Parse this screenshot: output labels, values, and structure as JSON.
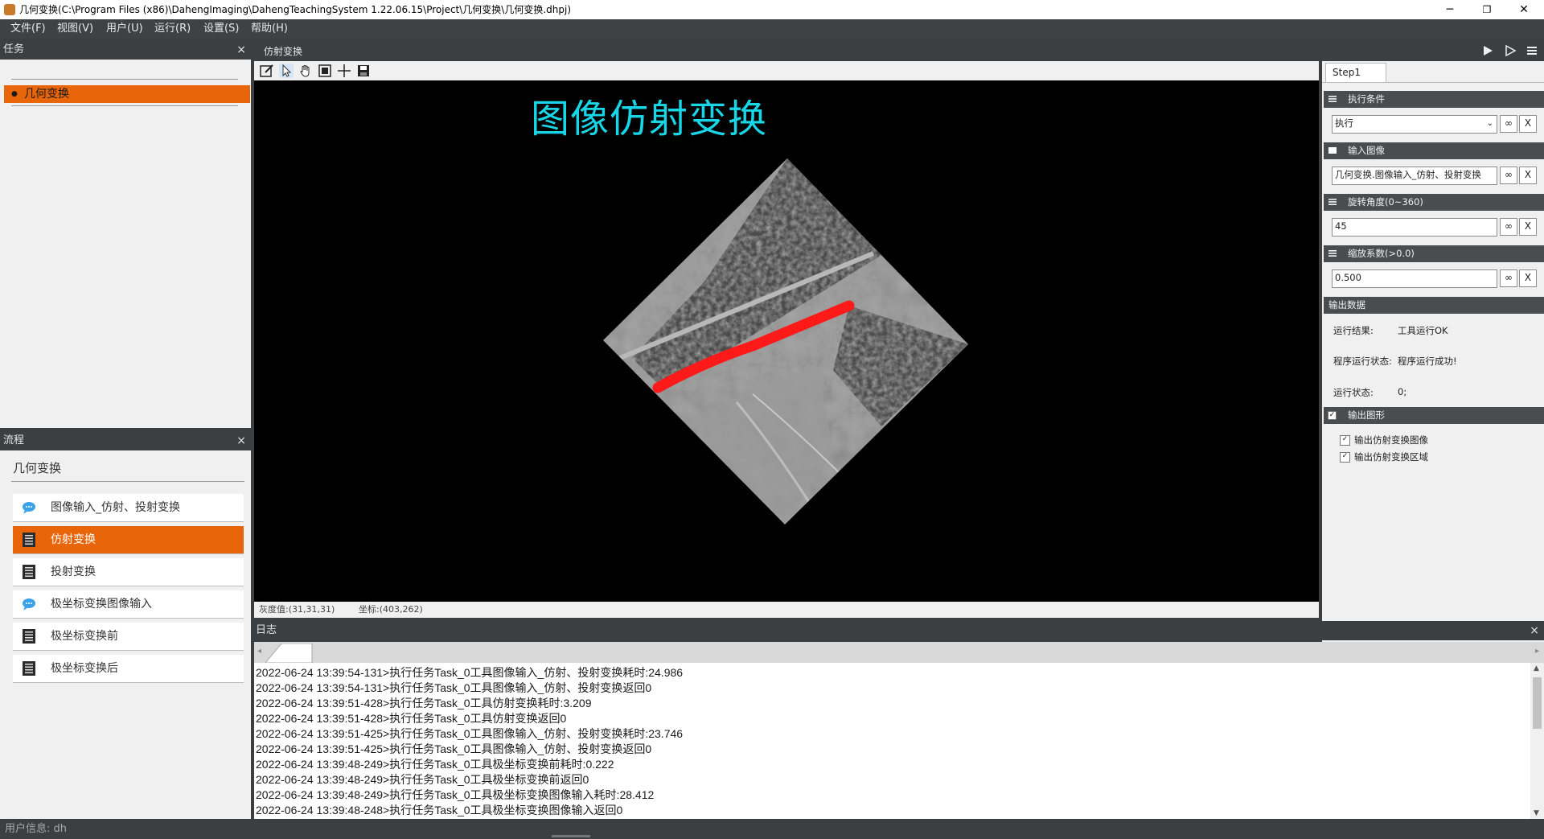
{
  "window": {
    "title": "几何变换(C:\\Program Files (x86)\\DahengImaging\\DahengTeachingSystem 1.22.06.15\\Project\\几何变换\\几何变换.dhpj)",
    "minimize": "─",
    "maximize": "❐",
    "close": "✕"
  },
  "menu": [
    "文件(F)",
    "视图(V)",
    "用户(U)",
    "运行(R)",
    "设置(S)",
    "帮助(H)"
  ],
  "task_panel": {
    "title": "任务",
    "close": "×",
    "items": [
      {
        "label": "几何变换",
        "bullet": "●"
      }
    ]
  },
  "flow_panel": {
    "title": "流程",
    "close": "×",
    "group": "几何变换",
    "items": [
      {
        "label": "图像输入_仿射、投射变换",
        "icon": "chat-bubble-icon"
      },
      {
        "label": "仿射变换",
        "icon": "list-doc-icon",
        "selected": true
      },
      {
        "label": "投射变换",
        "icon": "list-doc-icon"
      },
      {
        "label": "极坐标变换图像输入",
        "icon": "chat-bubble-icon"
      },
      {
        "label": "极坐标变换前",
        "icon": "list-doc-icon"
      },
      {
        "label": "极坐标变换后",
        "icon": "list-doc-icon"
      }
    ]
  },
  "view": {
    "title": "仿射变换",
    "overlay_text": "图像仿射变换",
    "status_gray": "灰度值:(31,31,31)",
    "status_coord": "坐标:(403,262)"
  },
  "right_panel": {
    "tab": "Step1",
    "sections": {
      "exec_condition": {
        "title": "执行条件",
        "value": "执行"
      },
      "input_image": {
        "title": "输入图像",
        "value": "几何变换.图像输入_仿射、投射变换"
      },
      "rotation": {
        "title": "旋转角度(0~360)",
        "value": "45"
      },
      "scale": {
        "title": "缩放系数(>0.0)",
        "value": "0.500"
      },
      "output_data": {
        "title": "输出数据",
        "rows": [
          {
            "label": "运行结果:",
            "value": "工具运行OK"
          },
          {
            "label": "程序运行状态:",
            "value": "程序运行成功!"
          },
          {
            "label": "运行状态:",
            "value": "0;"
          }
        ]
      },
      "output_graphics": {
        "title": "输出图形",
        "items": [
          {
            "label": "输出仿射变换图像",
            "checked": true
          },
          {
            "label": "输出仿射变换区域",
            "checked": true
          }
        ]
      }
    },
    "link_symbol": "∞",
    "clear_symbol": "X"
  },
  "log": {
    "title": "日志",
    "close": "×",
    "lines": [
      "2022-06-24 13:39:54-131>执行任务Task_0工具图像输入_仿射、投射变换耗时:24.986",
      "2022-06-24 13:39:54-131>执行任务Task_0工具图像输入_仿射、投射变换返回0",
      "2022-06-24 13:39:51-428>执行任务Task_0工具仿射变换耗时:3.209",
      "2022-06-24 13:39:51-428>执行任务Task_0工具仿射变换返回0",
      "2022-06-24 13:39:51-425>执行任务Task_0工具图像输入_仿射、投射变换耗时:23.746",
      "2022-06-24 13:39:51-425>执行任务Task_0工具图像输入_仿射、投射变换返回0",
      "2022-06-24 13:39:48-249>执行任务Task_0工具极坐标变换前耗时:0.222",
      "2022-06-24 13:39:48-249>执行任务Task_0工具极坐标变换前返回0",
      "2022-06-24 13:39:48-249>执行任务Task_0工具极坐标变换图像输入耗时:28.412",
      "2022-06-24 13:39:48-248>执行任务Task_0工具极坐标变换图像输入返回0"
    ]
  },
  "footer": {
    "user_info": "用户信息: dh"
  },
  "colors": {
    "accent": "#e8650a",
    "overlay_text": "#19d6e6",
    "region": "#ff1a1a"
  }
}
